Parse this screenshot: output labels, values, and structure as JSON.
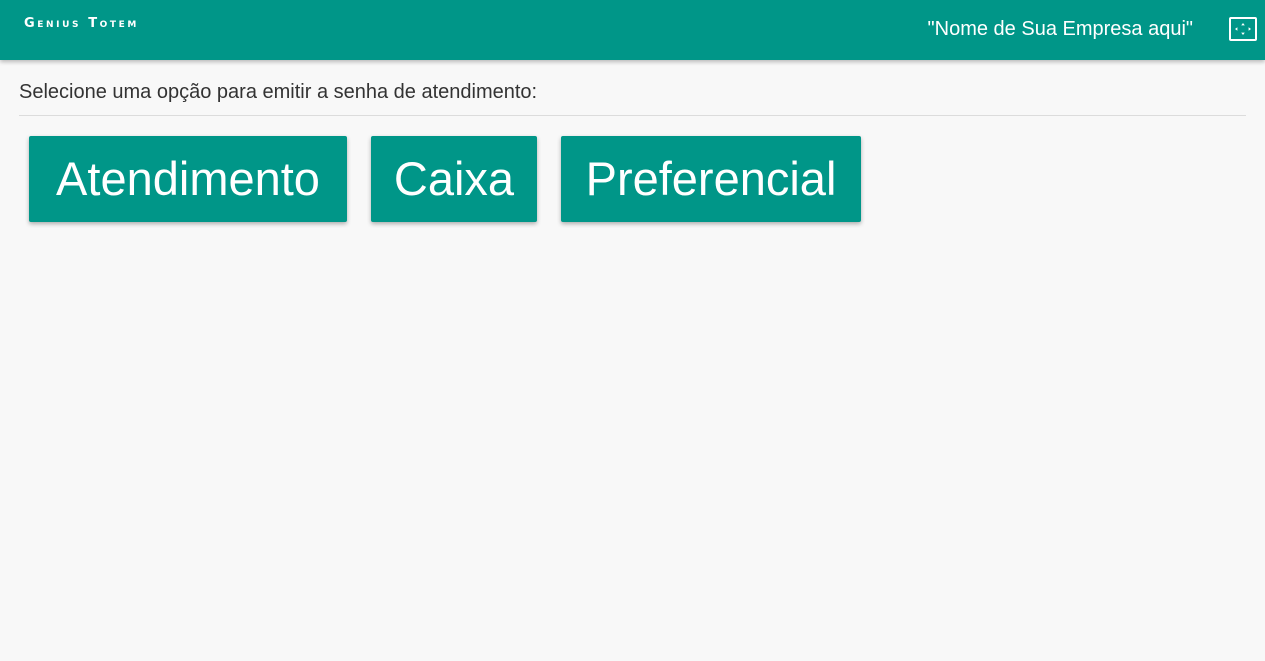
{
  "header": {
    "app_title": "Genius Totem",
    "company_name": "\"Nome de Sua Empresa aqui\"",
    "fullscreen_icon": "fullscreen-icon"
  },
  "main": {
    "instruction": "Selecione uma opção para emitir a senha de atendimento:",
    "options": [
      {
        "label": "Atendimento"
      },
      {
        "label": "Caixa"
      },
      {
        "label": "Preferencial"
      }
    ]
  },
  "colors": {
    "primary": "#009688",
    "background": "#f8f8f8",
    "text": "#333333"
  }
}
